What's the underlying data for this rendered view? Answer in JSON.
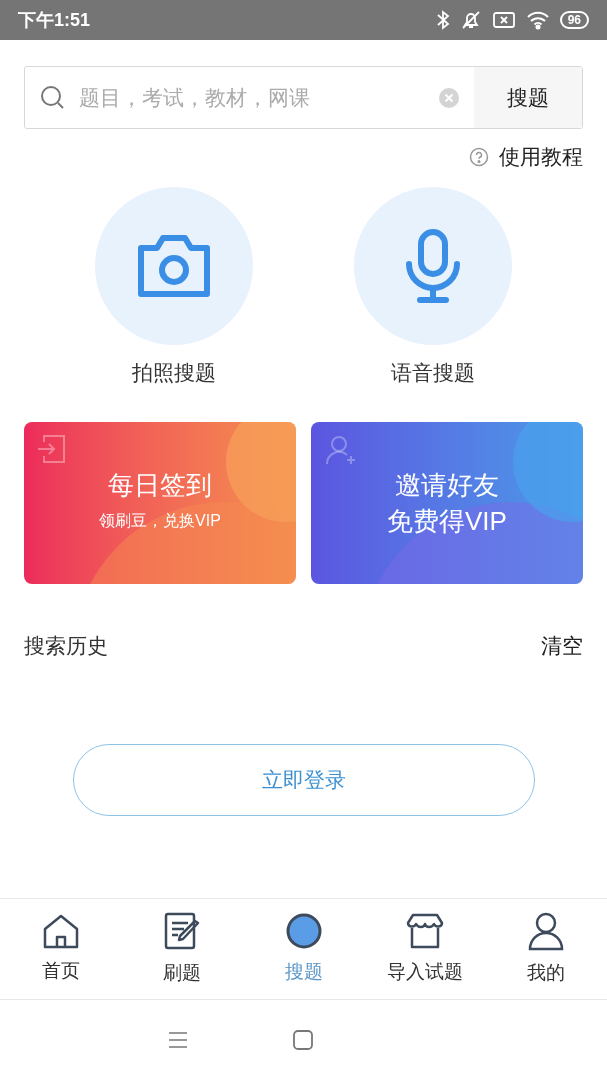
{
  "status_bar": {
    "time": "下午1:51",
    "battery": "96"
  },
  "search": {
    "placeholder": "题目，考试，教材，网课",
    "button": "搜题"
  },
  "help_link": "使用教程",
  "search_modes": [
    {
      "kind": "camera",
      "label": "拍照搜题"
    },
    {
      "kind": "voice",
      "label": "语音搜题"
    }
  ],
  "promo_cards": [
    {
      "kind": "checkin",
      "title": "每日签到",
      "subtitle": "领刷豆，兑换VIP"
    },
    {
      "kind": "invite",
      "title": "邀请好友",
      "subtitle": "免费得VIP"
    }
  ],
  "history": {
    "title": "搜索历史",
    "clear": "清空"
  },
  "login_button": "立即登录",
  "tabs": [
    {
      "kind": "home",
      "label": "首页",
      "selected": false
    },
    {
      "kind": "practice",
      "label": "刷题",
      "selected": false
    },
    {
      "kind": "search",
      "label": "搜题",
      "selected": true
    },
    {
      "kind": "import",
      "label": "导入试题",
      "selected": false
    },
    {
      "kind": "me",
      "label": "我的",
      "selected": false
    }
  ]
}
